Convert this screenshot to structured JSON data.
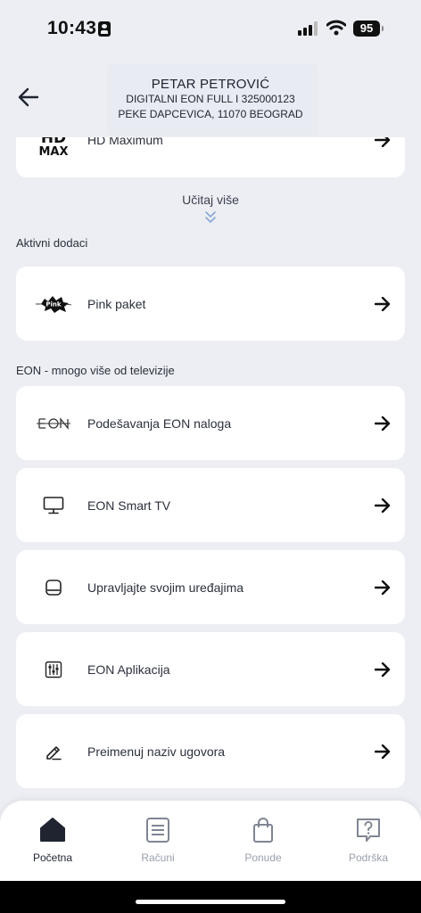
{
  "status_bar": {
    "time": "10:43",
    "battery": "95"
  },
  "header": {
    "title": "PETAR PETROVIĆ",
    "contract": "DIGITALNI EON FULL I 325000123",
    "address": "PEKE DAPCEVICA, 11070 BEOGRAD"
  },
  "package_card": {
    "logo_top": "HD",
    "logo_bottom": "MAX",
    "label": "HD Maximum"
  },
  "load_more": {
    "label": "Učitaj više"
  },
  "active_addons": {
    "title": "Aktivni dodaci",
    "items": [
      {
        "label": "Pink paket",
        "icon": "pink-logo-icon",
        "logo_text": "Pink"
      }
    ]
  },
  "eon_section": {
    "title": "EON - mnogo više od televizije",
    "items": [
      {
        "label": "Podešavanja EON naloga",
        "icon": "eon-logo-icon"
      },
      {
        "label": "EON Smart TV",
        "icon": "tv-icon"
      },
      {
        "label": "Upravljajte svojim uređajima",
        "icon": "device-icon"
      },
      {
        "label": "EON Aplikacija",
        "icon": "sliders-icon"
      },
      {
        "label": "Preimenuj naziv ugovora",
        "icon": "pencil-icon"
      }
    ]
  },
  "tabbar": {
    "tabs": [
      {
        "label": "Početna",
        "icon": "home-icon",
        "active": true
      },
      {
        "label": "Računi",
        "icon": "document-icon",
        "active": false
      },
      {
        "label": "Ponude",
        "icon": "shopping-bag-icon",
        "active": false
      },
      {
        "label": "Podrška",
        "icon": "help-bubble-icon",
        "active": false
      }
    ]
  },
  "colors": {
    "background": "#eceef3",
    "card": "#ffffff",
    "text": "#1f2430",
    "muted": "#9aa0ac",
    "accent_chevron": "#8aa6d8"
  }
}
